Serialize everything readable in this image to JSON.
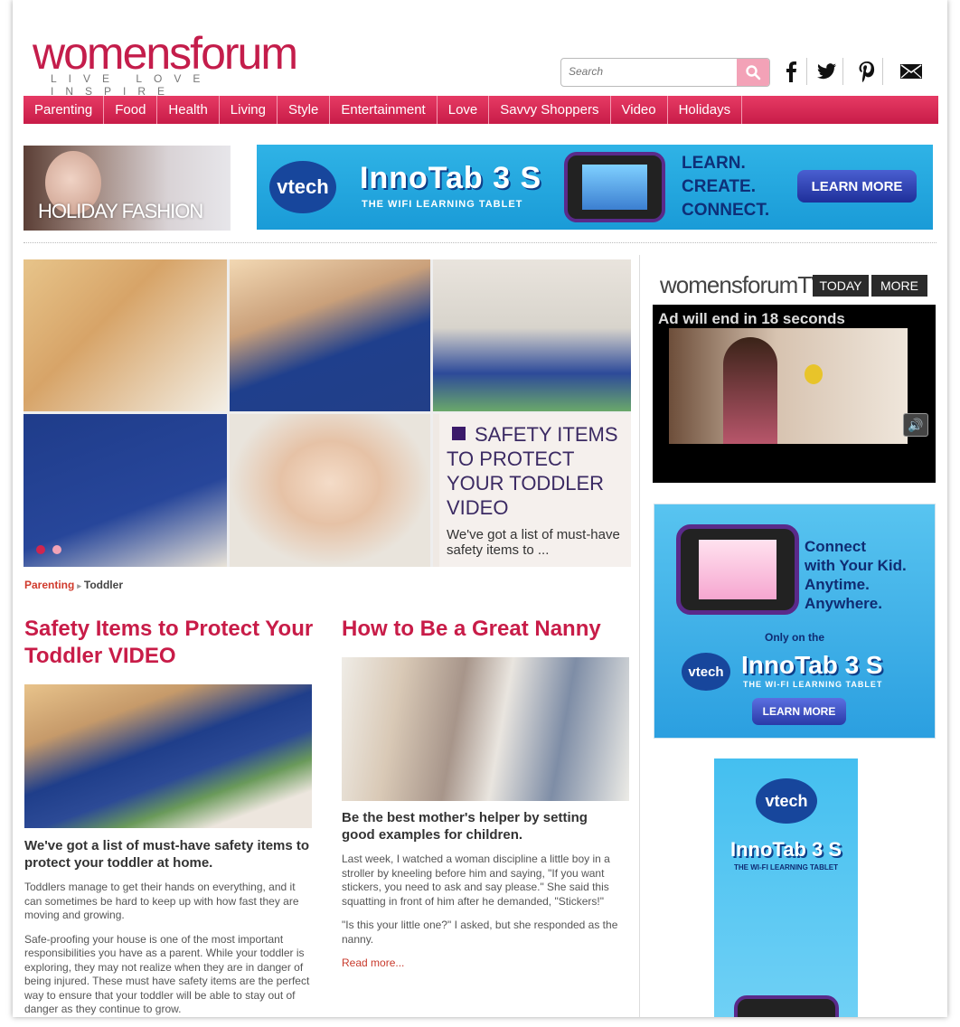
{
  "header": {
    "logo_text": "womensforum",
    "logo_tagline": "LIVE LOVE INSPIRE",
    "search_placeholder": "Search"
  },
  "nav": {
    "items": [
      "Parenting",
      "Food",
      "Health",
      "Living",
      "Style",
      "Entertainment",
      "Love",
      "Savvy Shoppers",
      "Video",
      "Holidays"
    ]
  },
  "promo": {
    "holiday_label": "HOLIDAY FASHION"
  },
  "banner": {
    "brand": "vtech",
    "product": "InnoTab 3 S",
    "subtitle": "THE WIFI LEARNING TABLET",
    "taglines": [
      "LEARN.",
      "CREATE.",
      "CONNECT."
    ],
    "cta": "LEARN MORE"
  },
  "hero": {
    "title": "SAFETY ITEMS TO PROTECT YOUR TODDLER VIDEO",
    "description": "We've got a list of must-have safety items to ..."
  },
  "breadcrumb": {
    "parent": "Parenting",
    "current": "Toddler"
  },
  "article1": {
    "title": "Safety Items to Protect Your Toddler VIDEO",
    "lead": "We've got a list of must-have safety items to protect your toddler at home.",
    "paragraphs": [
      "Toddlers manage to get their hands on everything, and it can sometimes be hard to keep up with how fast they are moving and growing.",
      "Safe-proofing your house is one of the most important responsibilities you have as a parent. While your toddler is exploring, they may not realize when they are in danger of being injured. These must have safety items are the perfect way to ensure that your toddler will be able to stay out of danger as they continue to grow."
    ]
  },
  "article2": {
    "title": "How to Be a Great Nanny",
    "lead": "Be the best mother's helper by setting good examples for children.",
    "paragraphs": [
      "Last week, I watched a woman discipline a little boy in a stroller by kneeling before him and saying, \"If you want stickers, you need to ask and say please.\" She said this squatting in front of him after he demanded, \"Stickers!\"",
      "\"Is this your little one?\" I asked, but she responded as the nanny."
    ],
    "read_more": "Read more..."
  },
  "sidebar": {
    "tv_logo": "womensforumTV",
    "tab_today": "TODAY",
    "tab_more": "MORE",
    "ad_countdown": "Ad will end in 18 seconds",
    "ad2": {
      "message": [
        "Connect",
        "with Your Kid.",
        "Anytime.",
        "Anywhere."
      ],
      "only_on": "Only on the",
      "brand": "vtech",
      "product": "InnoTab 3 S",
      "subtitle": "THE WI-FI LEARNING TABLET",
      "cta": "LEARN MORE"
    },
    "ad3": {
      "brand": "vtech",
      "product": "InnoTab 3 S",
      "subtitle": "THE WI-FI LEARNING TABLET"
    }
  },
  "colors": {
    "brand_pink": "#c81c48",
    "link_red": "#c83a2c",
    "hero_title": "#3b2a63"
  }
}
